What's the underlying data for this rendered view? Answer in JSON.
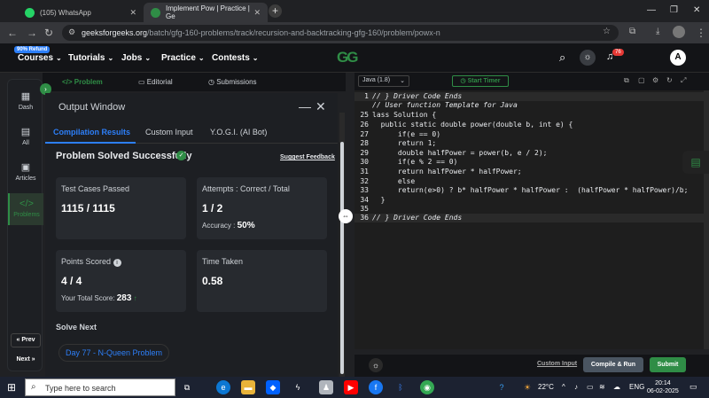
{
  "browser": {
    "tabs": [
      {
        "title": "(105) WhatsApp",
        "active": false
      },
      {
        "title": "Implement Pow | Practice | Ge",
        "active": true
      }
    ],
    "url_host": "geeksforgeeks.org",
    "url_path": "/batch/gfg-160-problems/track/recursion-and-backtracking-gfg-160/problem/powx-n"
  },
  "header": {
    "refund_badge": "90% Refund",
    "nav": [
      "Courses",
      "Tutorials",
      "Jobs",
      "Practice",
      "Contests"
    ],
    "logo": "GG",
    "notification_count": "76",
    "avatar_initial": "A"
  },
  "rail": {
    "items": [
      "Dash",
      "All",
      "Articles",
      "Problems"
    ],
    "prev": "« Prev",
    "next": "Next »"
  },
  "problem_tabs": [
    "</> Problem",
    "Editorial",
    "Submissions"
  ],
  "output": {
    "title": "Output Window",
    "tabs": [
      "Compilation Results",
      "Custom Input",
      "Y.O.G.I. (AI Bot)"
    ],
    "status": "Problem Solved Successfully",
    "feedback": "Suggest Feedback",
    "cards": {
      "tests_label": "Test Cases Passed",
      "tests_value": "1115 / 1115",
      "attempts_label": "Attempts : Correct / Total",
      "attempts_value": "1 / 2",
      "accuracy_label": "Accuracy :",
      "accuracy_value": "50%",
      "points_label": "Points Scored",
      "points_value": "4 / 4",
      "total_label": "Your Total Score:",
      "total_value": "283",
      "time_label": "Time Taken",
      "time_value": "0.58"
    },
    "solve_next": "Solve Next",
    "next_problem": "Day 77 - N-Queen Problem"
  },
  "editor": {
    "language": "Java (1.8)",
    "timer": "Start Timer",
    "lines": [
      {
        "n": "1",
        "text": "// } Driver Code Ends",
        "type": "cm",
        "fold": true
      },
      {
        "n": "",
        "text": "// User function Template for Java",
        "type": "cm",
        "fold": false
      },
      {
        "n": "25",
        "text": "lass Solution {",
        "type": "code",
        "fold": false
      },
      {
        "n": "26",
        "text": "  public static double power(double b, int e) {",
        "type": "code",
        "fold": false
      },
      {
        "n": "27",
        "text": "      if(e == 0)",
        "type": "code",
        "fold": false
      },
      {
        "n": "28",
        "text": "      return 1;",
        "type": "code",
        "fold": false
      },
      {
        "n": "29",
        "text": "      double halfPower = power(b, e / 2);",
        "type": "code",
        "fold": false
      },
      {
        "n": "30",
        "text": "      if(e % 2 == 0)",
        "type": "code",
        "fold": false
      },
      {
        "n": "31",
        "text": "      return halfPower * halfPower;",
        "type": "code",
        "fold": false
      },
      {
        "n": "32",
        "text": "      else",
        "type": "code",
        "fold": false
      },
      {
        "n": "33",
        "text": "      return(e>0) ? b* halfPower * halfPower :  (halfPower * halfPower)/b;",
        "type": "code",
        "fold": false
      },
      {
        "n": "34",
        "text": "  }",
        "type": "code",
        "fold": false
      },
      {
        "n": "35",
        "text": "",
        "type": "code",
        "fold": false
      },
      {
        "n": "36",
        "text": "// } Driver Code Ends",
        "type": "cm",
        "fold": true
      }
    ],
    "custom_input": "Custom Input",
    "compile_run": "Compile & Run",
    "submit": "Submit"
  },
  "taskbar": {
    "search_placeholder": "Type here to search",
    "weather": "22°C",
    "lang": "ENG",
    "time": "20:14",
    "date": "06-02-2025"
  },
  "colors": {
    "gfg_green": "#2f8d46",
    "accent_blue": "#2d7ff9"
  }
}
